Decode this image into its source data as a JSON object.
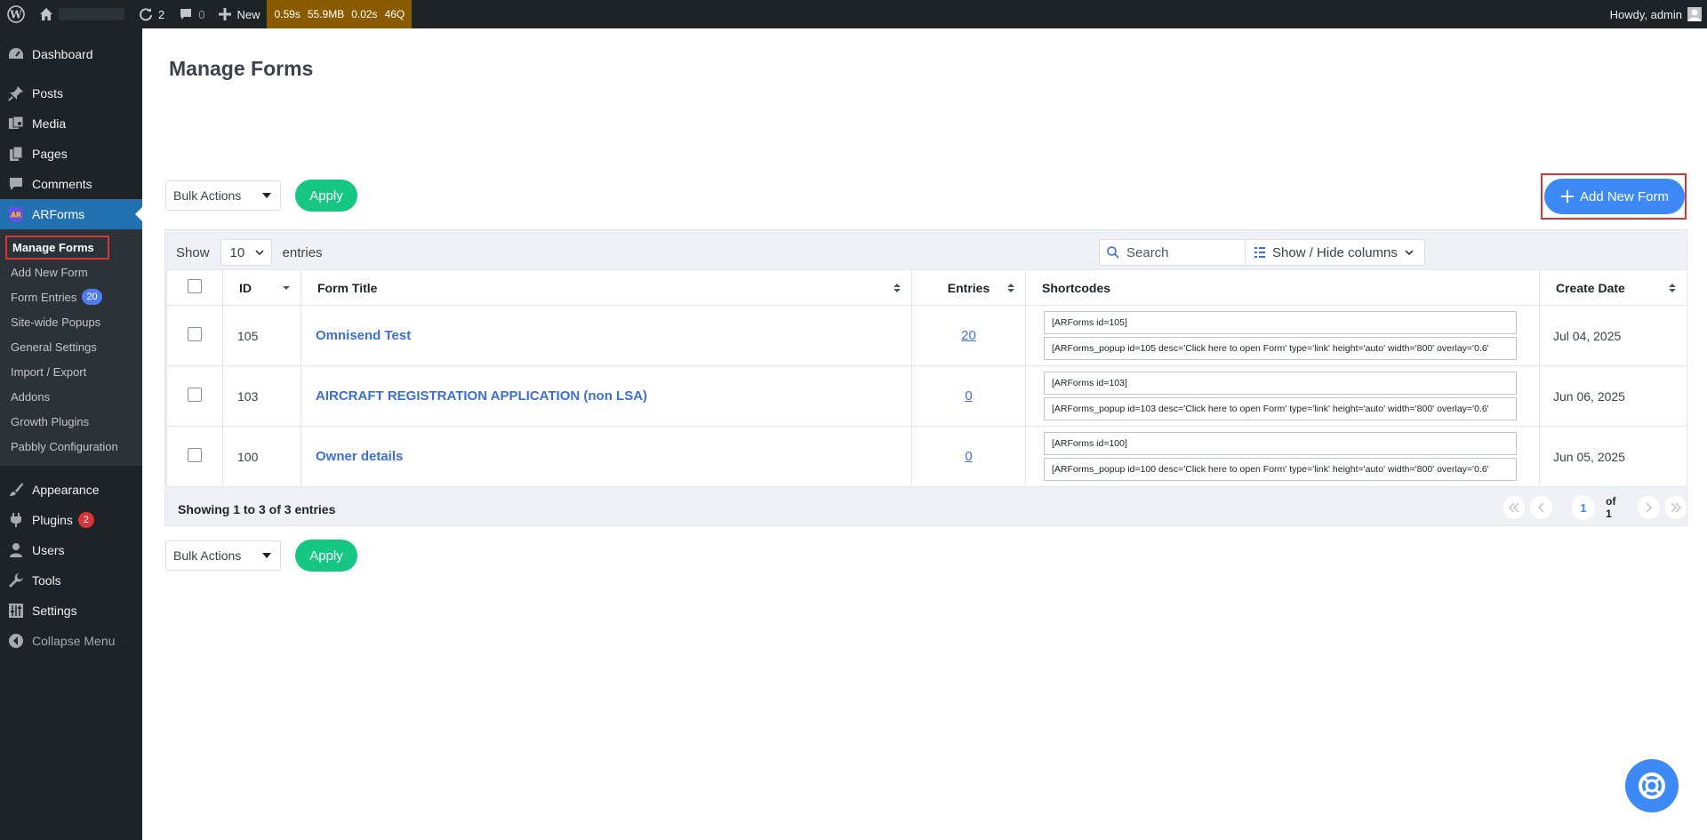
{
  "admin_bar": {
    "updates_count": "2",
    "comments_count": "0",
    "new_label": "New",
    "query_monitor": {
      "time": "0.59s",
      "memory": "55.9MB",
      "db_time": "0.02s",
      "queries": "46Q"
    },
    "greeting": "Howdy, admin"
  },
  "sidebar": {
    "dashboard": "Dashboard",
    "posts": "Posts",
    "media": "Media",
    "pages": "Pages",
    "comments": "Comments",
    "arforms": "ARForms",
    "submenu": {
      "manage_forms": "Manage Forms",
      "add_new_form": "Add New Form",
      "form_entries": "Form Entries",
      "form_entries_count": "20",
      "site_wide_popups": "Site-wide Popups",
      "general_settings": "General Settings",
      "import_export": "Import / Export",
      "addons": "Addons",
      "growth_plugins": "Growth Plugins",
      "pabbly": "Pabbly Configuration"
    },
    "appearance": "Appearance",
    "plugins": "Plugins",
    "plugins_count": "2",
    "users": "Users",
    "tools": "Tools",
    "settings": "Settings",
    "collapse": "Collapse Menu"
  },
  "page": {
    "title": "Manage Forms",
    "bulk_actions": "Bulk Actions",
    "apply": "Apply",
    "add_new_form": "Add New Form",
    "show": "Show",
    "entries_per_page": "10",
    "entries_label": "entries",
    "search_placeholder": "Search",
    "show_hide_columns": "Show / Hide columns"
  },
  "table": {
    "headers": {
      "id": "ID",
      "form_title": "Form Title",
      "entries": "Entries",
      "shortcodes": "Shortcodes",
      "create_date": "Create Date"
    },
    "rows": [
      {
        "id": "105",
        "title": "Omnisend Test",
        "entries": "20",
        "shortcode": "[ARForms id=105]",
        "popup_shortcode": "[ARForms_popup id=105 desc='Click here to open Form' type='link' height='auto' width='800' overlay='0.6'",
        "date": "Jul 04, 2025"
      },
      {
        "id": "103",
        "title": "AIRCRAFT REGISTRATION APPLICATION (non LSA)",
        "entries": "0",
        "shortcode": "[ARForms id=103]",
        "popup_shortcode": "[ARForms_popup id=103 desc='Click here to open Form' type='link' height='auto' width='800' overlay='0.6'",
        "date": "Jun 06, 2025"
      },
      {
        "id": "100",
        "title": "Owner details",
        "entries": "0",
        "shortcode": "[ARForms id=100]",
        "popup_shortcode": "[ARForms_popup id=100 desc='Click here to open Form' type='link' height='auto' width='800' overlay='0.6'",
        "date": "Jun 05, 2025"
      }
    ],
    "footer_info": "Showing 1 to 3 of 3 entries",
    "current_page": "1",
    "page_of": "of 1"
  },
  "colors": {
    "accent": "#3d8af7",
    "apply_green": "#16c784",
    "admin_bar": "#1d2327",
    "highlight_red": "#d63638"
  }
}
